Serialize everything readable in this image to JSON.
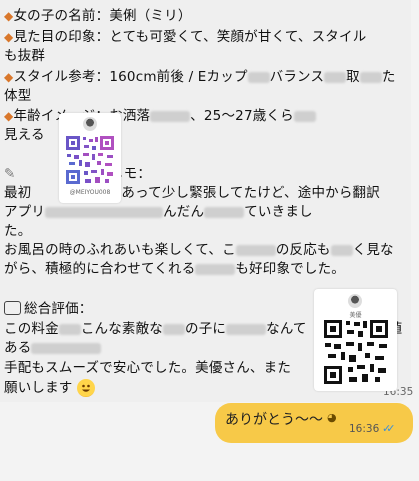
{
  "message_in": {
    "name_line": "女の子の名前：美俐（ミリ）",
    "impression_line1": "見た目の印象：とても可愛くて、笑顔が甘くて、スタイル",
    "impression_line2": "も抜群",
    "style_line1": "スタイル参考：160cm前後 / Eカップ",
    "style_line1b": "バランス",
    "style_line1c": "取",
    "style_line1d": "た",
    "style_line2": "体型",
    "age_line1a": "年齢イメージ：お洒落",
    "age_line1b": "、25～27歳くら",
    "age_line2": "見える",
    "memo_label": "メモ：",
    "memo_line1a": "最初",
    "memo_line1b": "あって少し緊張してたけど、途中から翻訳",
    "memo_line2a": "アプリ",
    "memo_line2b": "んだん",
    "memo_line2c": "ていきまし",
    "memo_line3": "た。",
    "memo_line4a": "お風呂の時のふれあいも楽しくて、こ",
    "memo_line4b": "の反応も",
    "memo_line4c": "く見な",
    "memo_line5a": "がら、積極的に合わせてくれる",
    "memo_line5b": "も好印象でした。",
    "review_label": "総合評価：",
    "review_line1a": "この料金",
    "review_line1b": "こんな素敵な",
    "review_line1c": "の子に",
    "review_line1d": "なんて",
    "review_line1e": "値",
    "review_line2a": "ある",
    "review_line3a": "手配もスムーズで安心でした。美優さん、また",
    "review_line3b": "お",
    "review_line4": "願いします",
    "time": "16:35"
  },
  "qr_left": {
    "caption": "@MEIYOU008"
  },
  "qr_right": {
    "caption": "美優"
  },
  "message_out": {
    "text": "ありがとう～～",
    "time": "16:36",
    "status": "✓✓"
  },
  "icons": {
    "bullet": "orange-diamond-icon",
    "memo": "pencil-icon",
    "review": "speech-bubble-icon",
    "emoji": "grinning-face-icon"
  },
  "colors": {
    "bubble_in": "#efefef",
    "bubble_out": "#f7c948",
    "bullet": "#d9772b",
    "check": "#3b8fd9"
  }
}
